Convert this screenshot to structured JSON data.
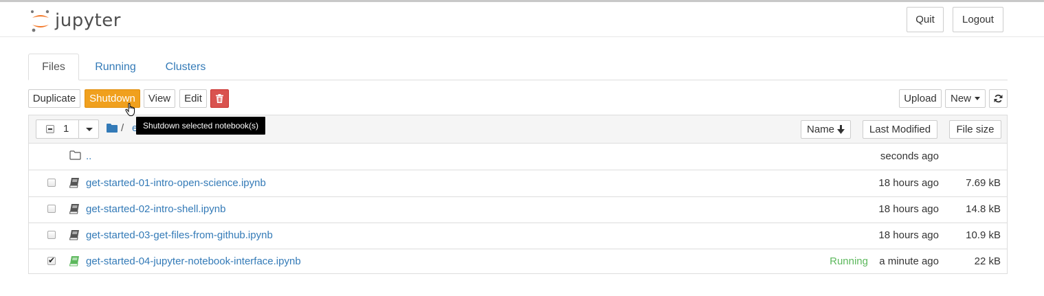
{
  "header": {
    "logo_text": "jupyter",
    "quit_label": "Quit",
    "logout_label": "Logout"
  },
  "tabs": [
    {
      "label": "Files",
      "active": true
    },
    {
      "label": "Running",
      "active": false
    },
    {
      "label": "Clusters",
      "active": false
    }
  ],
  "toolbar": {
    "duplicate_label": "Duplicate",
    "shutdown_label": "Shutdown",
    "view_label": "View",
    "edit_label": "Edit",
    "delete_icon": "trash-icon",
    "upload_label": "Upload",
    "new_label": "New",
    "refresh_icon": "refresh-icon",
    "shutdown_color": "#f0a01e",
    "delete_color": "#d9534f"
  },
  "tooltip": {
    "text": "Shutdown selected notebook(s)"
  },
  "list_header": {
    "selected_count": "1",
    "breadcrumb_sep": "/",
    "breadcrumb_partial": "e",
    "sort_name_label": "Name",
    "sort_modified_label": "Last Modified",
    "sort_size_label": "File size"
  },
  "rows": [
    {
      "type": "folder",
      "name": "..",
      "modified": "seconds ago",
      "size": "",
      "status": "",
      "checked": false
    },
    {
      "type": "notebook",
      "name": "get-started-01-intro-open-science.ipynb",
      "modified": "18 hours ago",
      "size": "7.69 kB",
      "status": "",
      "checked": false
    },
    {
      "type": "notebook",
      "name": "get-started-02-intro-shell.ipynb",
      "modified": "18 hours ago",
      "size": "14.8 kB",
      "status": "",
      "checked": false
    },
    {
      "type": "notebook",
      "name": "get-started-03-get-files-from-github.ipynb",
      "modified": "18 hours ago",
      "size": "10.9 kB",
      "status": "",
      "checked": false
    },
    {
      "type": "notebook-running",
      "name": "get-started-04-jupyter-notebook-interface.ipynb",
      "modified": "a minute ago",
      "size": "22 kB",
      "status": "Running",
      "checked": true
    }
  ],
  "colors": {
    "link": "#337ab7",
    "running": "#5cb85c",
    "logo_orange": "#f37726"
  }
}
